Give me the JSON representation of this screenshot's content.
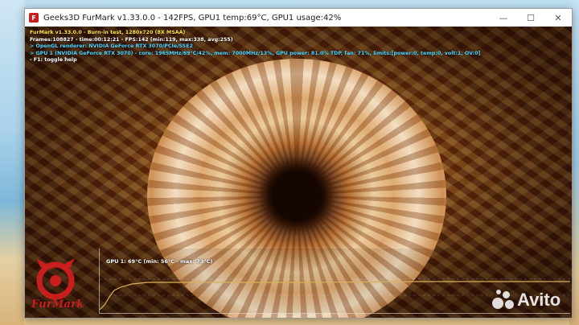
{
  "window": {
    "title": "Geeks3D FurMark v1.33.0.0 - 142FPS, GPU1 temp:69°C, GPU1 usage:42%",
    "icon": "furmark-app-icon",
    "controls": [
      "minimize-icon",
      "maximize-icon",
      "close-icon"
    ]
  },
  "hud": {
    "line1": "FurMark v1.33.0.0 - Burn-in test, 1280x720 (8X MSAA)",
    "line2": "Frames:108827 - time:00:12:21 - FPS:142 (min:119, max:338, avg:255)",
    "line3": "> OpenGL renderer: NVIDIA GeForce RTX 3070/PCIe/SSE2",
    "line4": "> GPU 1 (NVIDIA GeForce RTX 3070) - core: 1965MHz/69°C/42%, mem: 7000MHz/13%, GPU power: 81.0% TDP, fan: 71%, limits:[power:0, temp:0, volt:1, OV:0]",
    "line5": "- F1: toggle help"
  },
  "graph": {
    "label": "GPU 1: 69°C (min: 56°C - max: 73°C)",
    "line_color": "#d8b15a"
  },
  "logo": {
    "text": "FurMark",
    "color": "#c81e1e"
  },
  "watermark": {
    "text": "Avito"
  },
  "colors": {
    "hud_yellow": "#ffe34a",
    "hud_cyan": "#4fd7ff",
    "hud_white": "#ffffff"
  }
}
